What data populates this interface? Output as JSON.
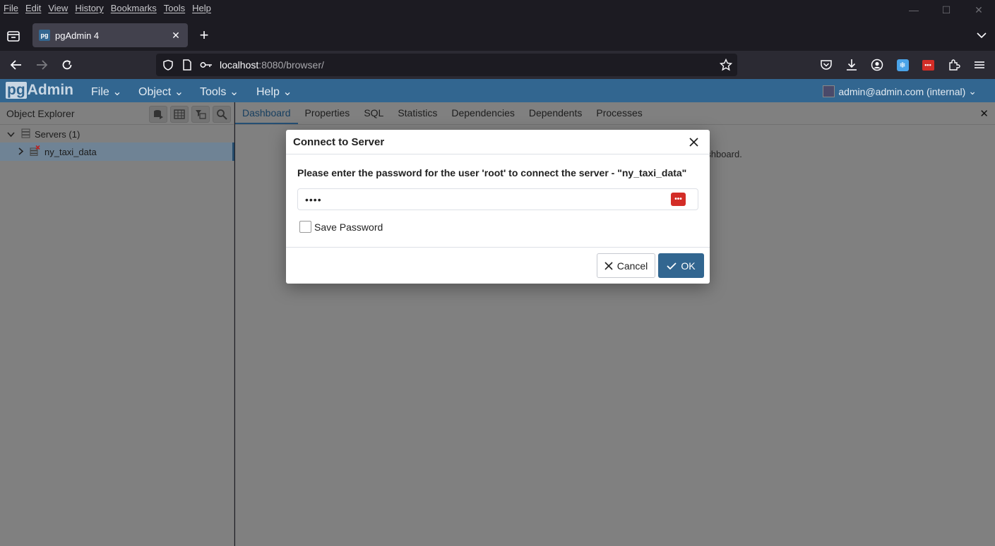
{
  "browser": {
    "menu": [
      "File",
      "Edit",
      "View",
      "History",
      "Bookmarks",
      "Tools",
      "Help"
    ],
    "tab_title": "pgAdmin 4",
    "tab_favicon": "pg",
    "url_host": "localhost",
    "url_rest": ":8080/browser/"
  },
  "pgadmin": {
    "logo_pg": "pg",
    "logo_admin": "Admin",
    "menus": [
      "File",
      "Object",
      "Tools",
      "Help"
    ],
    "user": "admin@admin.com (internal)",
    "accent": "#326690"
  },
  "object_explorer": {
    "title": "Object Explorer",
    "tree": [
      {
        "label": "Servers (1)"
      },
      {
        "label": "ny_taxi_data"
      }
    ]
  },
  "main_tabs": [
    "Dashboard",
    "Properties",
    "SQL",
    "Statistics",
    "Dependencies",
    "Dependents",
    "Processes"
  ],
  "dashboard_message_fragment": "ashboard.",
  "dialog": {
    "title": "Connect to Server",
    "message": "Please enter the password for the user 'root' to connect the server - \"ny_taxi_data\"",
    "password_value": "••••",
    "save_password_label": "Save Password",
    "save_password_checked": false,
    "cancel_label": "Cancel",
    "ok_label": "OK"
  }
}
